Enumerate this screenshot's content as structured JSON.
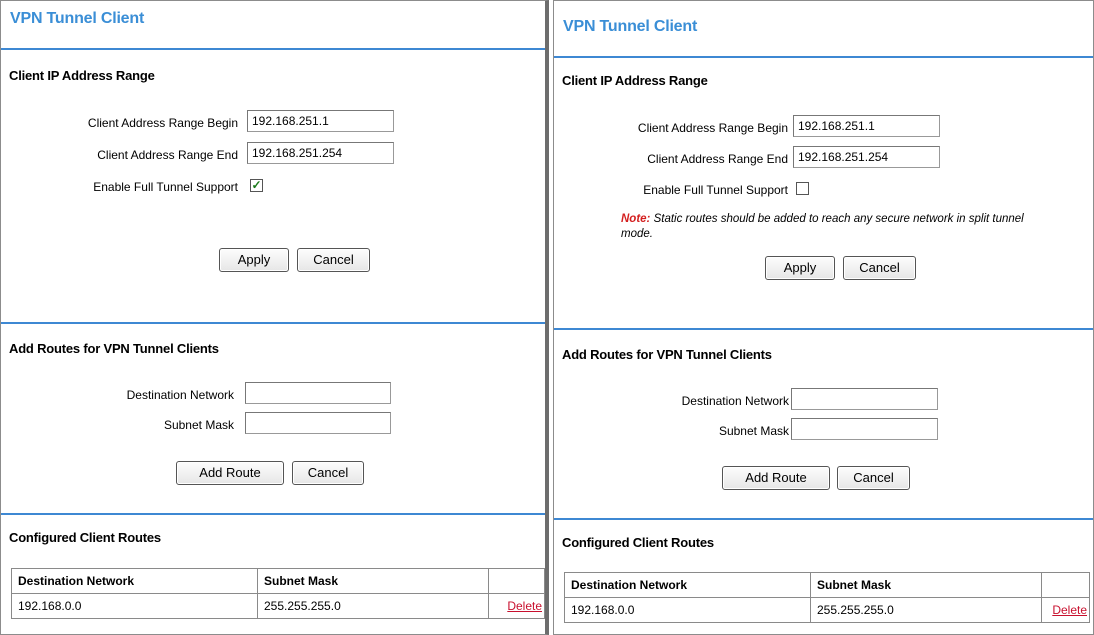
{
  "panels": [
    {
      "title": "VPN Tunnel Client",
      "client_ip": {
        "section_title": "Client IP Address Range",
        "begin_label": "Client Address Range Begin",
        "begin_value": "192.168.251.1",
        "end_label": "Client Address Range End",
        "end_value": "192.168.251.254",
        "full_tunnel_label": "Enable Full Tunnel Support",
        "full_tunnel_checked": true,
        "apply_label": "Apply",
        "cancel_label": "Cancel"
      },
      "add_routes": {
        "section_title": "Add Routes for VPN Tunnel Clients",
        "dest_label": "Destination Network",
        "dest_value": "",
        "mask_label": "Subnet Mask",
        "mask_value": "",
        "add_label": "Add Route",
        "cancel_label": "Cancel"
      },
      "configured": {
        "section_title": "Configured Client Routes",
        "headers": [
          "Destination Network",
          "Subnet Mask",
          ""
        ],
        "rows": [
          {
            "dest": "192.168.0.0",
            "mask": "255.255.255.0",
            "action": "Delete"
          }
        ]
      }
    },
    {
      "title": "VPN Tunnel Client",
      "client_ip": {
        "section_title": "Client IP Address Range",
        "begin_label": "Client Address Range Begin",
        "begin_value": "192.168.251.1",
        "end_label": "Client Address Range End",
        "end_value": "192.168.251.254",
        "full_tunnel_label": "Enable Full Tunnel Support",
        "full_tunnel_checked": false,
        "note_label": "Note:",
        "note_text": " Static routes should be added to reach any secure network in split tunnel mode.",
        "apply_label": "Apply",
        "cancel_label": "Cancel"
      },
      "add_routes": {
        "section_title": "Add Routes for VPN Tunnel Clients",
        "dest_label": "Destination Network",
        "dest_value": "",
        "mask_label": "Subnet Mask",
        "mask_value": "",
        "add_label": "Add Route",
        "cancel_label": "Cancel"
      },
      "configured": {
        "section_title": "Configured Client Routes",
        "headers": [
          "Destination Network",
          "Subnet Mask",
          ""
        ],
        "rows": [
          {
            "dest": "192.168.0.0",
            "mask": "255.255.255.0",
            "action": "Delete"
          }
        ]
      }
    }
  ],
  "colors": {
    "title": "#3a8ed6",
    "separator": "#3e88d3",
    "note": "#d42020",
    "delete_link": "#c8102e",
    "checkmark": "#1a7a1a"
  }
}
